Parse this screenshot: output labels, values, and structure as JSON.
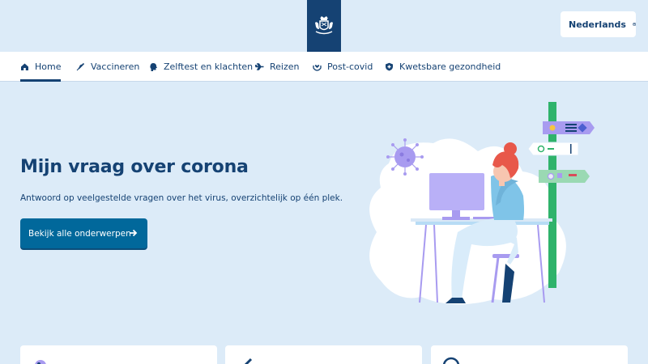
{
  "header": {
    "language_label": "Nederlands",
    "logo_icon": "royal-coat-of-arms-icon",
    "language_icon": "globe-icon"
  },
  "nav": {
    "items": [
      {
        "label": "Home",
        "icon": "home-icon",
        "active": true
      },
      {
        "label": "Vaccineren",
        "icon": "syringe-icon"
      },
      {
        "label": "Zelftest en klachten",
        "icon": "person-head-icon"
      },
      {
        "label": "Reizen",
        "icon": "airplane-icon"
      },
      {
        "label": "Post-covid",
        "icon": "hands-heart-icon"
      },
      {
        "label": "Kwetsbare gezondheid",
        "icon": "shield-icon"
      }
    ]
  },
  "hero": {
    "title": "Mijn vraag over corona",
    "subtitle": "Antwoord op veelgestelde vragen over het virus, overzichtelijk op één plek.",
    "cta_label": "Bekijk alle onderwerpen",
    "cta_icon": "arrow-right-icon"
  },
  "colors": {
    "page_bg": "#dcebf8",
    "brand_blue": "#154273",
    "button_blue": "#01689b",
    "accent_purple": "#a89bf0",
    "accent_green": "#2fb36b"
  }
}
